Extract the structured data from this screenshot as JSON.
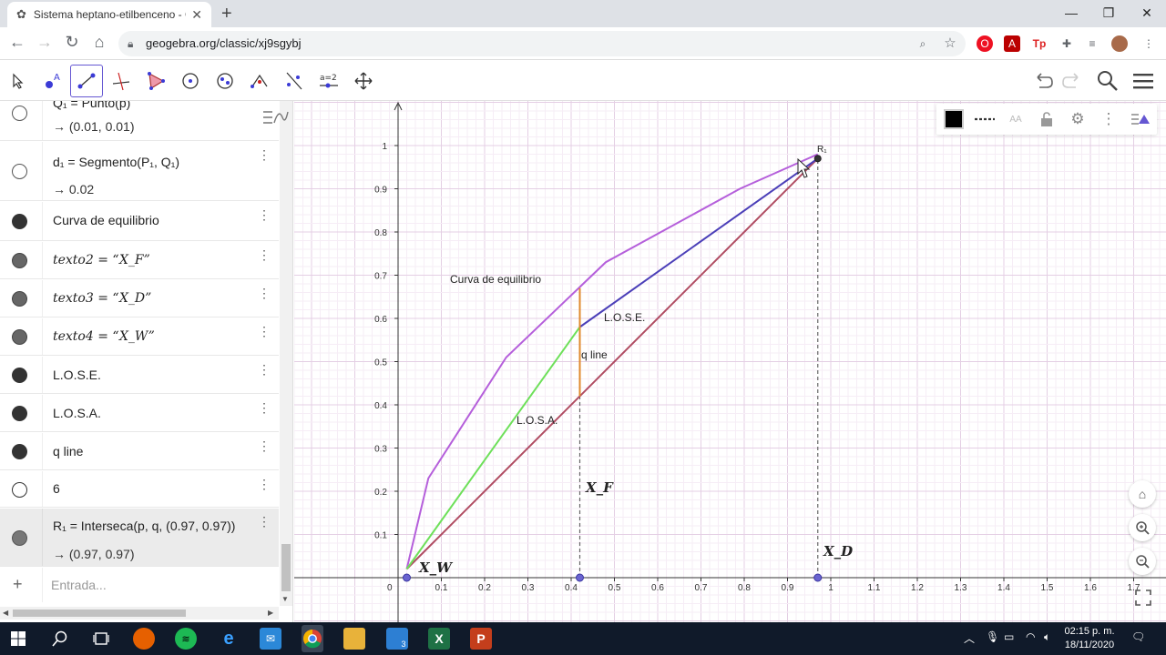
{
  "browser": {
    "tab_title": "Sistema heptano-etilbenceno - G",
    "url": "geogebra.org/classic/xj9sgybj"
  },
  "algebra": {
    "rows": [
      {
        "main": "Q₁ = Punto(p)",
        "out": "→ (0.01, 0.01)"
      },
      {
        "main": "d₁ = Segmento(P₁, Q₁)",
        "out": "→ 0.02"
      },
      {
        "main": "Curva de equilibrio"
      },
      {
        "main": "texto2 = “X_F”"
      },
      {
        "main": "texto3 = “X_D”"
      },
      {
        "main": "texto4 = “X_W”"
      },
      {
        "main": "L.O.S.E."
      },
      {
        "main": "L.O.S.A."
      },
      {
        "main": "q line"
      },
      {
        "main": "6"
      },
      {
        "main": "R₁ = Interseca(p, q, (0.97, 0.97))",
        "out": "→ (0.97, 0.97)"
      }
    ],
    "input_placeholder": "Entrada..."
  },
  "graphics": {
    "labels": {
      "curva": "Curva de equilibrio",
      "lose": "L.O.S.E.",
      "losa": "L.O.S.A.",
      "qline": "q line",
      "xw": "X_W",
      "xf": "X_F",
      "xd": "X_D",
      "r1": "R₁"
    },
    "tick_labels_x": [
      "0",
      "0.1",
      "0.2",
      "0.3",
      "0.4",
      "0.5",
      "0.6",
      "0.7",
      "0.8",
      "0.9",
      "1",
      "1.1",
      "1.2",
      "1.3",
      "1.4",
      "1.5",
      "1.6",
      "1.7"
    ],
    "tick_labels_y": [
      "0.1",
      "0.2",
      "0.3",
      "0.4",
      "0.5",
      "0.6",
      "0.7",
      "0.8",
      "0.9",
      "1"
    ]
  },
  "chart_data": {
    "type": "line",
    "xlim": [
      0,
      1.7
    ],
    "ylim": [
      0,
      1.1
    ],
    "grid": true,
    "series": [
      {
        "x": [
          0.02,
          0.07,
          0.25,
          0.48,
          0.79,
          0.97
        ],
        "y": [
          0.02,
          0.23,
          0.51,
          0.73,
          0.9,
          0.98
        ],
        "color": "#b55fdb"
      },
      {
        "x": [
          0.02,
          0.97
        ],
        "y": [
          0.02,
          0.97
        ],
        "color": "#b04c62"
      },
      {
        "x": [
          0.42,
          0.97
        ],
        "y": [
          0.58,
          0.97
        ],
        "color": "#4b3fb8"
      },
      {
        "x": [
          0.02,
          0.42
        ],
        "y": [
          0.02,
          0.58
        ],
        "color": "#6ee05a"
      },
      {
        "x": [
          0.42,
          0.42
        ],
        "y": [
          0.42,
          0.67
        ],
        "color": "#e08a2e"
      }
    ],
    "points": [
      {
        "x": 0.02,
        "y": 0
      },
      {
        "x": 0.42,
        "y": 0
      },
      {
        "x": 0.97,
        "y": 0
      },
      {
        "x": 0.97,
        "y": 0.97
      }
    ],
    "dashed_verticals": [
      0.42,
      0.97
    ]
  },
  "taskbar": {
    "time": "02:15 p. m.",
    "date": "18/11/2020"
  }
}
